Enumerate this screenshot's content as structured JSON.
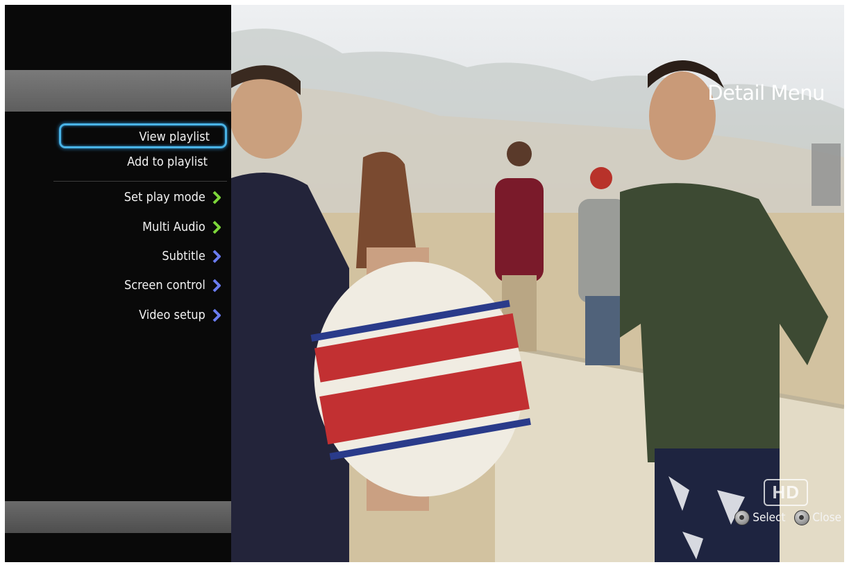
{
  "menu": {
    "title": "Detail Menu",
    "items": [
      {
        "label": "View playlist",
        "selected": true,
        "has_submenu": false
      },
      {
        "label": "Add to playlist",
        "selected": false,
        "has_submenu": false
      },
      {
        "label": "Set play mode",
        "selected": false,
        "has_submenu": true
      },
      {
        "label": "Multi Audio",
        "selected": false,
        "has_submenu": true
      },
      {
        "label": "Subtitle",
        "selected": false,
        "has_submenu": true
      },
      {
        "label": "Screen control",
        "selected": false,
        "has_submenu": true
      },
      {
        "label": "Video setup",
        "selected": false,
        "has_submenu": true
      }
    ],
    "footer": {
      "select_label": "Select",
      "close_label": "Close",
      "select_icon": "ok-button-icon",
      "close_icon": "return-button-icon"
    }
  },
  "video": {
    "badge": "HD"
  },
  "colors": {
    "selection_border": "#49b3e6",
    "chevron_green": "#7dd63a",
    "chevron_blue": "#6a7cf0",
    "panel_background": "#090909",
    "header_gray": "#6e6e6e"
  }
}
